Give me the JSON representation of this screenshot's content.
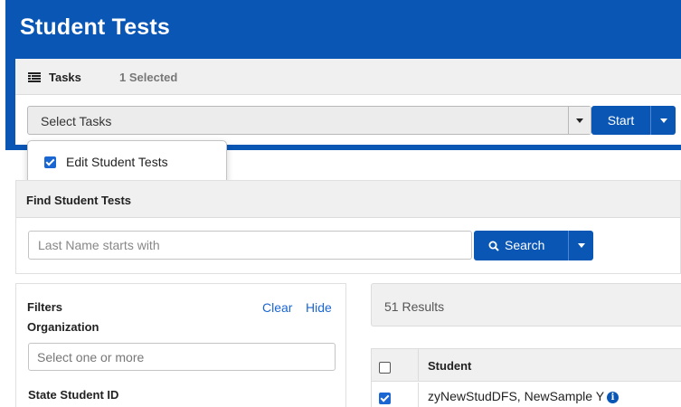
{
  "header": {
    "title": "Student Tests"
  },
  "tasks": {
    "label": "Tasks",
    "selected_count": "1 Selected",
    "select_text": "Select Tasks",
    "start_label": "Start",
    "dropdown_items": [
      {
        "label": "Edit Student Tests",
        "checked": true
      }
    ]
  },
  "find": {
    "title": "Find Student Tests",
    "search_placeholder": "Last Name starts with",
    "search_label": "Search"
  },
  "filters": {
    "title": "Filters",
    "clear_label": "Clear",
    "hide_label": "Hide",
    "organization_label": "Organization",
    "organization_placeholder": "Select one or more",
    "state_student_id_label": "State Student ID"
  },
  "results": {
    "count_text": "51 Results",
    "columns": [
      "Student"
    ],
    "rows": [
      {
        "student": "zyNewStudDFS, NewSample Y",
        "checked": true
      }
    ]
  },
  "colors": {
    "primary": "#0a56b5",
    "link": "#1a66d2",
    "panel": "#f0f0f0"
  }
}
